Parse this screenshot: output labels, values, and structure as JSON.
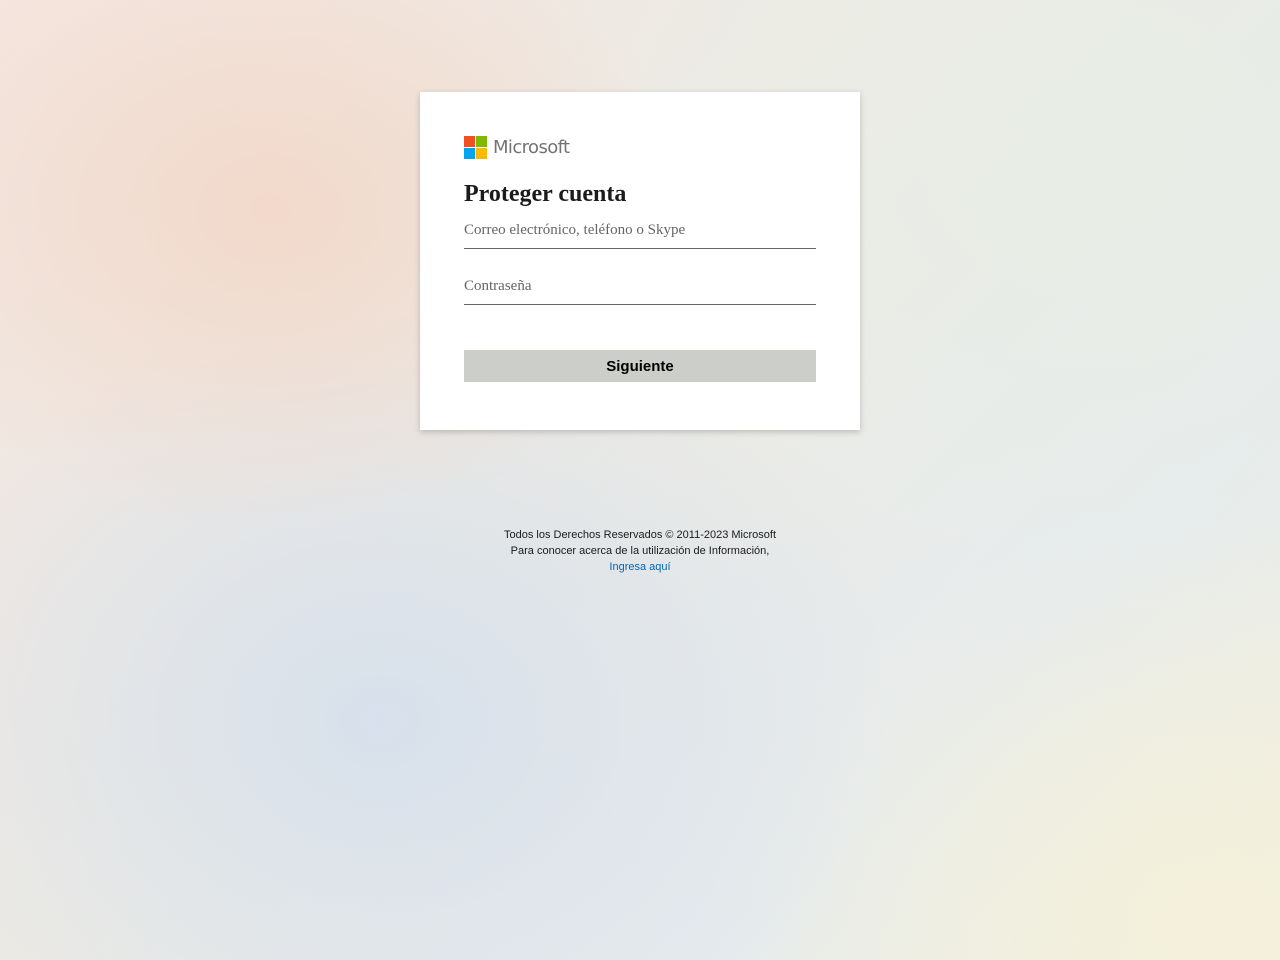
{
  "brand": {
    "name": "Microsoft",
    "logo_colors": [
      "#f25022",
      "#7fba00",
      "#00a4ef",
      "#ffb900"
    ]
  },
  "card": {
    "title": "Proteger cuenta",
    "email_field": {
      "placeholder": "Correo electrónico, teléfono o Skype",
      "value": ""
    },
    "password_field": {
      "placeholder": "Contraseña",
      "value": ""
    },
    "next_button": {
      "label": "Siguiente",
      "color": "#ccceca"
    }
  },
  "footer": {
    "copyright": "Todos los Derechos Reservados © 2011-2023 Microsoft",
    "info_text": "Para conocer acerca de la utilización de Información,",
    "link_label": "Ingresa aquí",
    "link_color": "#0067b8"
  }
}
